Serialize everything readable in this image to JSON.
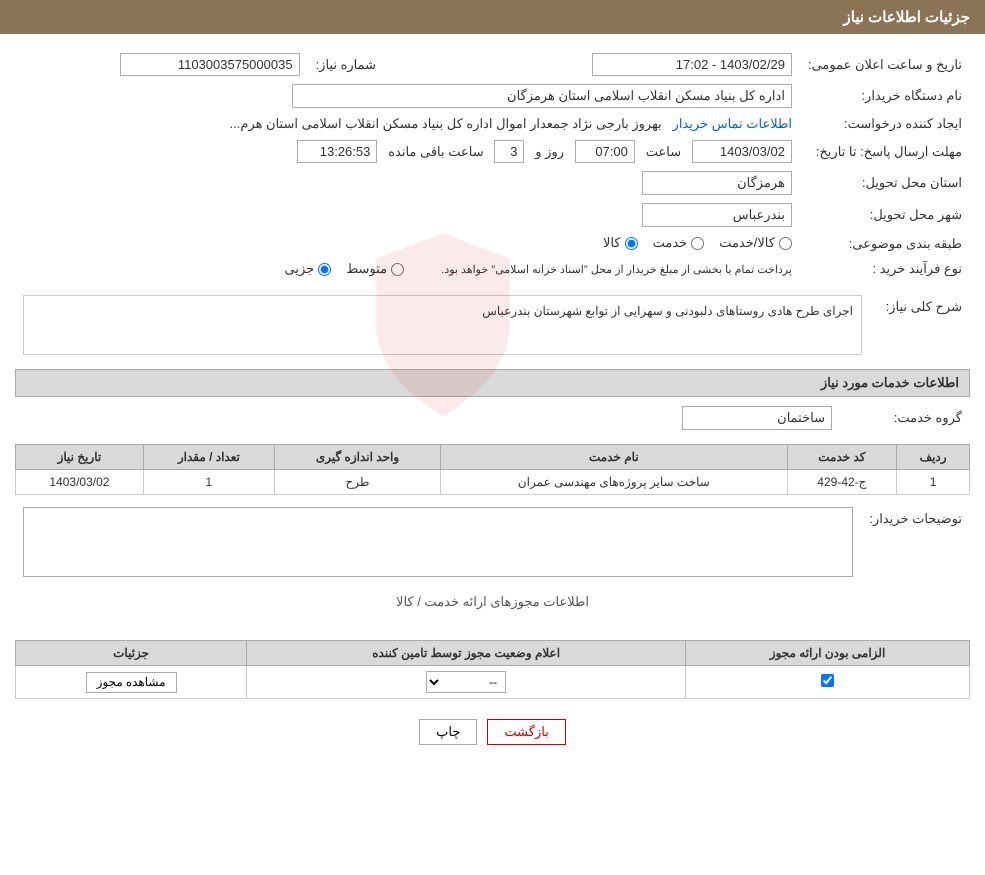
{
  "page": {
    "title": "جزئیات اطلاعات نیاز"
  },
  "header": {
    "label": "شماره نیاز:",
    "number_label": "نام دستگاه خریدار:",
    "creator_label": "ایجاد کننده درخواست:",
    "deadline_label": "مهلت ارسال پاسخ: تا تاریخ:",
    "province_label": "استان محل تحویل:",
    "city_label": "شهر محل تحویل:",
    "category_label": "طبقه بندی موضوعی:",
    "process_label": "نوع فرآیند خرید :"
  },
  "fields": {
    "request_number": "1103003575000035",
    "public_announce_label": "تاریخ و ساعت اعلان عمومی:",
    "public_announce_value": "1403/02/29 - 17:02",
    "buyer_org": "اداره کل بنیاد مسکن انقلاب اسلامی استان هرمزگان",
    "creator_link": "اطلاعات تماس خریدار",
    "creator_name": "بهروز بارجی نژاد جمعدار اموال اداره کل بنیاد مسکن انقلاب اسلامی استان هرم...",
    "deadline_date": "1403/03/02",
    "deadline_time_label": "ساعت",
    "deadline_time": "07:00",
    "deadline_days_label": "روز و",
    "deadline_days": "3",
    "remaining_label": "ساعت باقی مانده",
    "remaining_time": "13:26:53",
    "province": "هرمزگان",
    "city": "بندرعباس",
    "category_options": [
      "کالا",
      "خدمت",
      "کالا/خدمت"
    ],
    "category_selected": "کالا",
    "process_options": [
      "جزیی",
      "متوسط"
    ],
    "process_note": "پرداخت تمام یا بخشی از مبلغ خریدار از محل \"اسناد خزانه اسلامی\" خواهد بود.",
    "description_label": "شرح کلی نیاز:",
    "description_text": "اجرای طرح هادی روستاهای دلبودنی و سهرایی از توابع شهرستان بندرعباس"
  },
  "services_section": {
    "title": "اطلاعات خدمات مورد نیاز",
    "group_label": "گروه خدمت:",
    "group_value": "ساختمان",
    "table": {
      "headers": [
        "ردیف",
        "کد خدمت",
        "نام خدمت",
        "واحد اندازه گیری",
        "تعداد / مقدار",
        "تاریخ نیاز"
      ],
      "rows": [
        {
          "row": "1",
          "code": "ج-42-429",
          "name": "ساخت سایر پروژه‌های مهندسی عمران",
          "unit": "طرح",
          "qty": "1",
          "date": "1403/03/02"
        }
      ]
    }
  },
  "buyer_notes": {
    "label": "توضیحات خریدار:",
    "value": ""
  },
  "permissions_section": {
    "title": "اطلاعات مجوزهای ارائه خدمت / کالا",
    "table": {
      "headers": [
        "الزامی بودن ارائه مجوز",
        "اعلام وضعیت مجوز توسط تامین کننده",
        "جزئیات"
      ],
      "rows": [
        {
          "required": true,
          "status": "--",
          "details_btn": "مشاهده مجوز"
        }
      ]
    }
  },
  "buttons": {
    "print": "چاپ",
    "back": "بازگشت"
  }
}
